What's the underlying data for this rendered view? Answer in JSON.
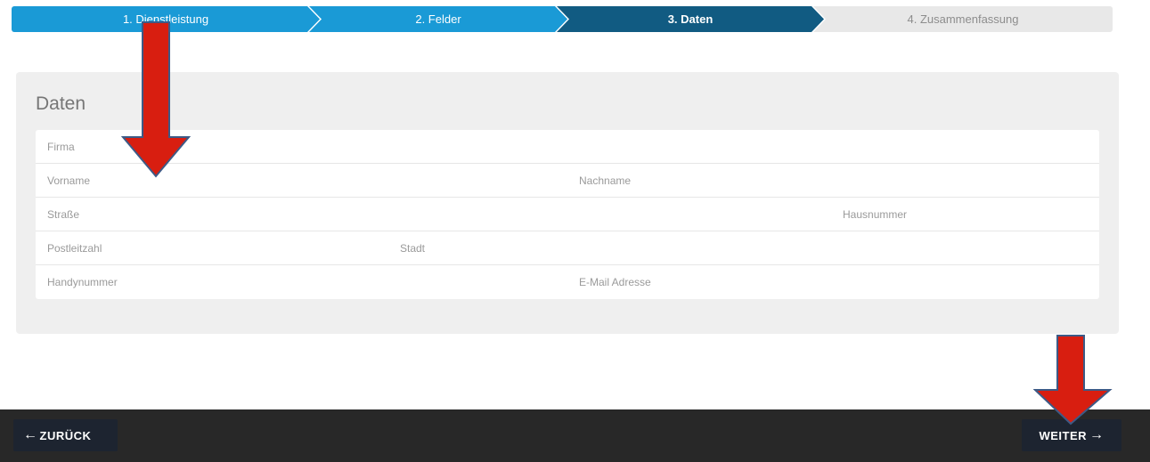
{
  "stepper": {
    "steps": [
      {
        "label": "1. Dienstleistung",
        "state": "completed"
      },
      {
        "label": "2. Felder",
        "state": "completed"
      },
      {
        "label": "3. Daten",
        "state": "active"
      },
      {
        "label": "4. Zusammenfassung",
        "state": "pending"
      }
    ]
  },
  "form": {
    "title": "Daten",
    "fields": {
      "firma": "Firma",
      "vorname": "Vorname",
      "nachname": "Nachname",
      "strasse": "Straße",
      "hausnummer": "Hausnummer",
      "postleitzahl": "Postleitzahl",
      "stadt": "Stadt",
      "handynummer": "Handynummer",
      "email": "E-Mail Adresse"
    }
  },
  "footer": {
    "back_label": "ZURÜCK",
    "back_icon": "arrow-left-icon",
    "next_label": "WEITER",
    "next_icon": "arrow-right-icon"
  },
  "colors": {
    "step_completed": "#1a9ad6",
    "step_active": "#115b82",
    "step_pending": "#e8e8e8",
    "footer_bg": "#282828",
    "button_bg": "#1d2430",
    "annotation_arrow": "#d81e10"
  }
}
